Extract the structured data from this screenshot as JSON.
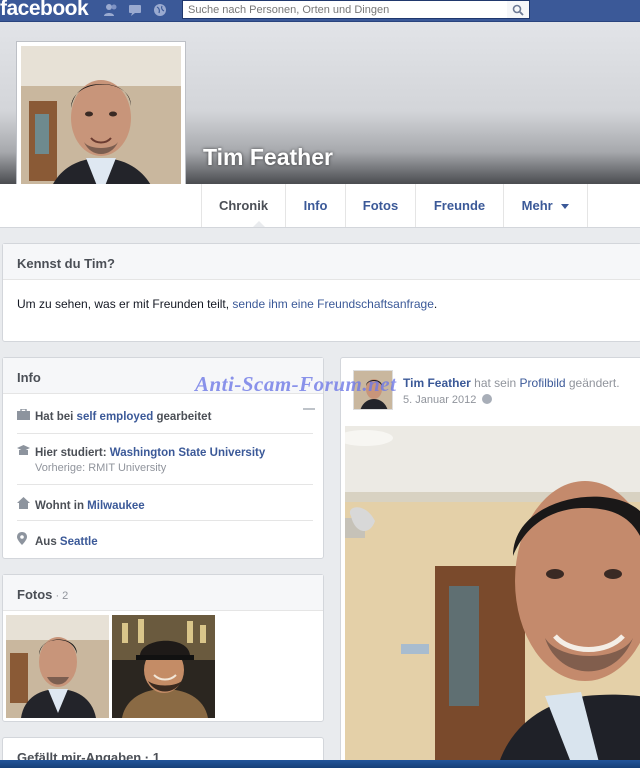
{
  "topbar": {
    "logo": "facebook",
    "search_placeholder": "Suche nach Personen, Orten und Dingen",
    "icons": [
      "friends-icon",
      "messages-icon",
      "notifications-icon",
      "search-icon"
    ]
  },
  "profile": {
    "name": "Tim Feather"
  },
  "tabs": [
    {
      "label": "Chronik"
    },
    {
      "label": "Info"
    },
    {
      "label": "Fotos"
    },
    {
      "label": "Freunde"
    },
    {
      "label": "Mehr"
    }
  ],
  "know_card": {
    "title": "Kennst du Tim?",
    "text": "Um zu sehen, was er mit Freunden teilt, ",
    "link": "sende ihm eine Freundschaftsanfrage",
    "end": "."
  },
  "info_card": {
    "title": "Info",
    "work_prefix": "Hat bei ",
    "work_link": "self employed",
    "work_suffix": " gearbeitet",
    "study_prefix": "Hier studiert: ",
    "study_link": "Washington State University",
    "study_prev": "Vorherige: RMIT University",
    "lives_prefix": "Wohnt in ",
    "lives_link": "Milwaukee",
    "from_prefix": "Aus ",
    "from_link": "Seattle"
  },
  "photos_card": {
    "title": "Fotos",
    "count": " · 2"
  },
  "bottom_card": {
    "title": "Gefällt mir-Angaben · 1"
  },
  "post": {
    "author": "Tim Feather",
    "action": " hat sein ",
    "link": "Profilbild",
    "action_end": " geändert.",
    "date": "5. Januar 2012"
  },
  "watermark": "Anti-Scam-Forum.net",
  "colors": {
    "brand": "#3b5998",
    "background": "#e9ebee",
    "watermark": "#6e78e6"
  }
}
